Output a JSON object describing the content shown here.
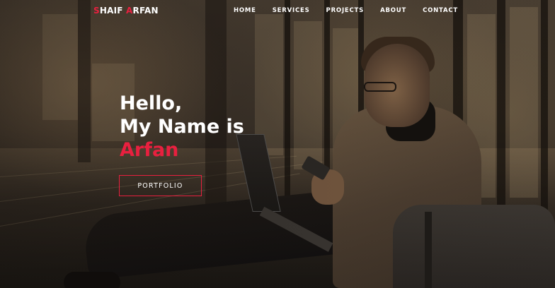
{
  "navbar": {
    "brand": {
      "first_initial": "S",
      "first_rest": "HAIF ",
      "last_initial": "A",
      "last_rest": "RFAN"
    },
    "links": [
      "HOME",
      "SERVICES",
      "PROJECTS",
      "ABOUT",
      "CONTACT"
    ]
  },
  "hero": {
    "line1": "Hello,",
    "line2": "My Name is",
    "name": "Arfan",
    "cta_label": "PORTFOLIO"
  },
  "colors": {
    "accent": "#e8203f",
    "text": "#ffffff"
  }
}
